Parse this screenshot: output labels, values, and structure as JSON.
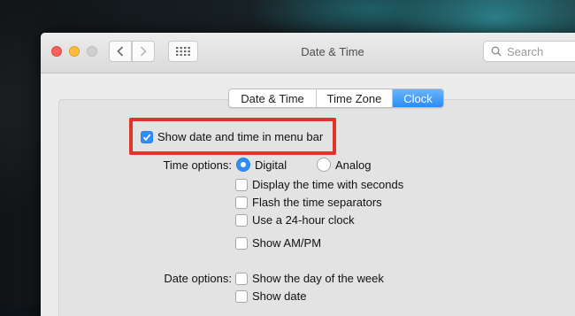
{
  "window": {
    "title": "Date & Time",
    "search_placeholder": "Search"
  },
  "tabs": [
    {
      "label": "Date & Time",
      "active": false
    },
    {
      "label": "Time Zone",
      "active": false
    },
    {
      "label": "Clock",
      "active": true
    }
  ],
  "clock": {
    "show_in_menu_bar": {
      "label": "Show date and time in menu bar",
      "checked": true
    },
    "time_options_label": "Time options:",
    "time_format": {
      "digital": {
        "label": "Digital",
        "selected": true
      },
      "analog": {
        "label": "Analog",
        "selected": false
      }
    },
    "display_seconds": {
      "label": "Display the time with seconds",
      "checked": false
    },
    "flash_separators": {
      "label": "Flash the time separators",
      "checked": false
    },
    "use_24_hour": {
      "label": "Use a 24-hour clock",
      "checked": false
    },
    "show_am_pm": {
      "label": "Show AM/PM",
      "checked": false
    },
    "date_options_label": "Date options:",
    "show_day_of_week": {
      "label": "Show the day of the week",
      "checked": false
    },
    "show_date": {
      "label": "Show date",
      "checked": false
    }
  },
  "colors": {
    "accent": "#2d8ff7",
    "highlight_box": "#e2352a"
  },
  "icons": {
    "back": "chevron-left-icon",
    "forward": "chevron-right-icon",
    "grid": "grid-icon",
    "search": "search-icon",
    "checkmark": "checkmark-icon"
  }
}
